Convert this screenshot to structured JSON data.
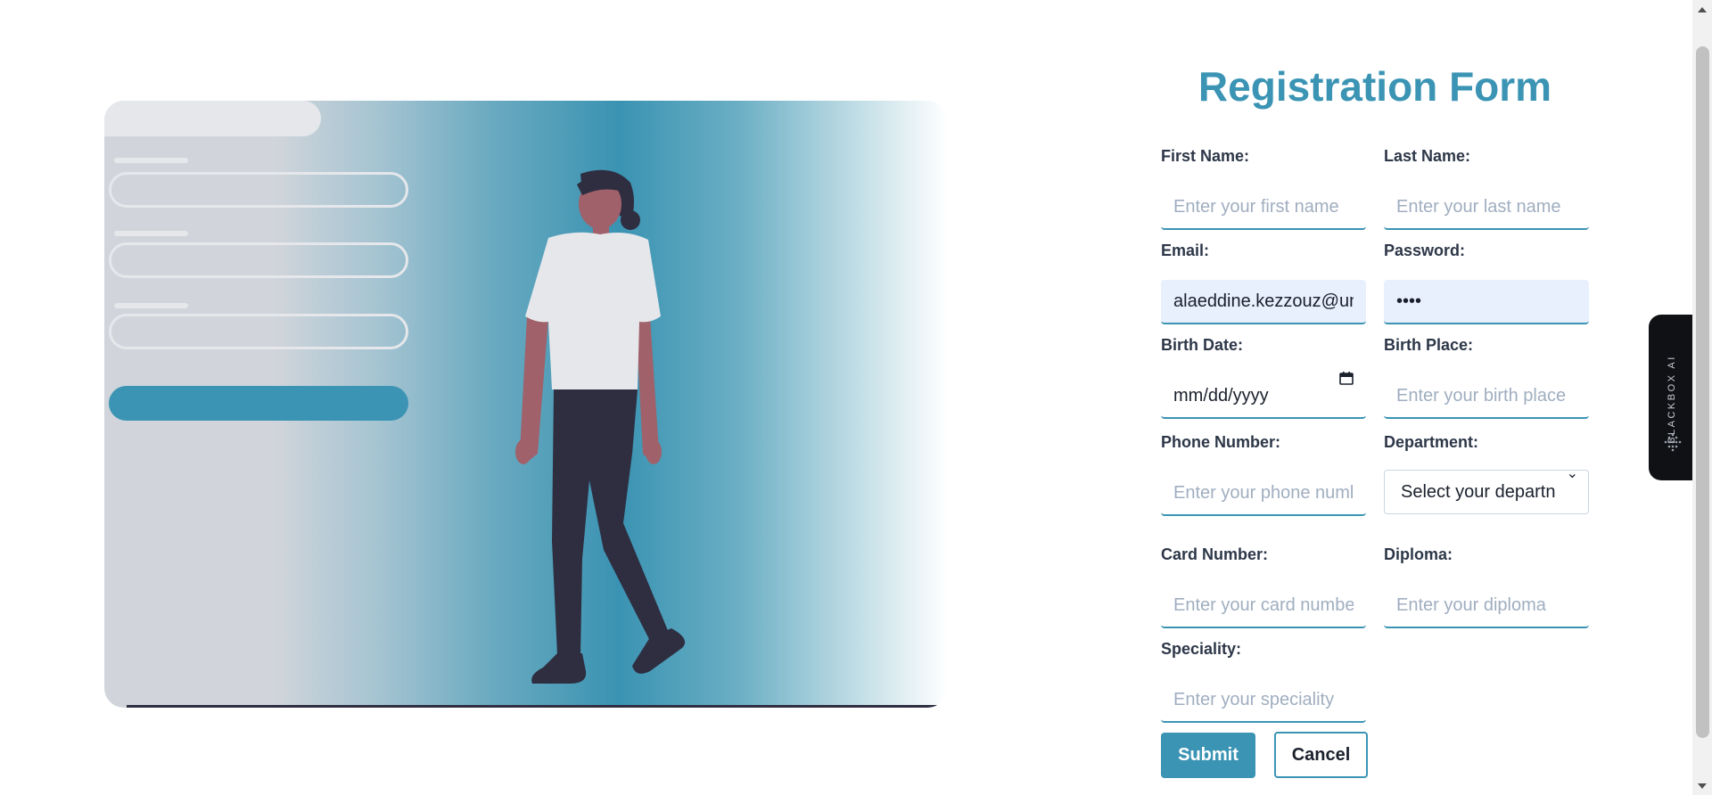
{
  "form": {
    "title": "Registration Form",
    "fields": {
      "first_name": {
        "label": "First Name:",
        "placeholder": "Enter your first name",
        "value": ""
      },
      "last_name": {
        "label": "Last Name:",
        "placeholder": "Enter your last name",
        "value": ""
      },
      "email": {
        "label": "Email:",
        "placeholder": "",
        "value": "alaeddine.kezzouz@un"
      },
      "password": {
        "label": "Password:",
        "placeholder": "",
        "value": "••••"
      },
      "birth_date": {
        "label": "Birth Date:",
        "value": "mm/dd/yyyy"
      },
      "birth_place": {
        "label": "Birth Place:",
        "placeholder": "Enter your birth place",
        "value": ""
      },
      "phone": {
        "label": "Phone Number:",
        "placeholder": "Enter your phone numl",
        "value": ""
      },
      "department": {
        "label": "Department:",
        "selected": "Select your departn"
      },
      "card_number": {
        "label": "Card Number:",
        "placeholder": "Enter your card numbe",
        "value": ""
      },
      "diploma": {
        "label": "Diploma:",
        "placeholder": "Enter your diploma",
        "value": ""
      },
      "speciality": {
        "label": "Speciality:",
        "placeholder": "Enter your speciality",
        "value": ""
      }
    },
    "buttons": {
      "submit": "Submit",
      "cancel": "Cancel"
    }
  },
  "widget": {
    "label": "BLACKBOX AI",
    "icon": "blackbox-logo-icon"
  },
  "colors": {
    "accent": "#3b94b4",
    "text": "#2d3748",
    "autofill": "#e8f0fe"
  }
}
